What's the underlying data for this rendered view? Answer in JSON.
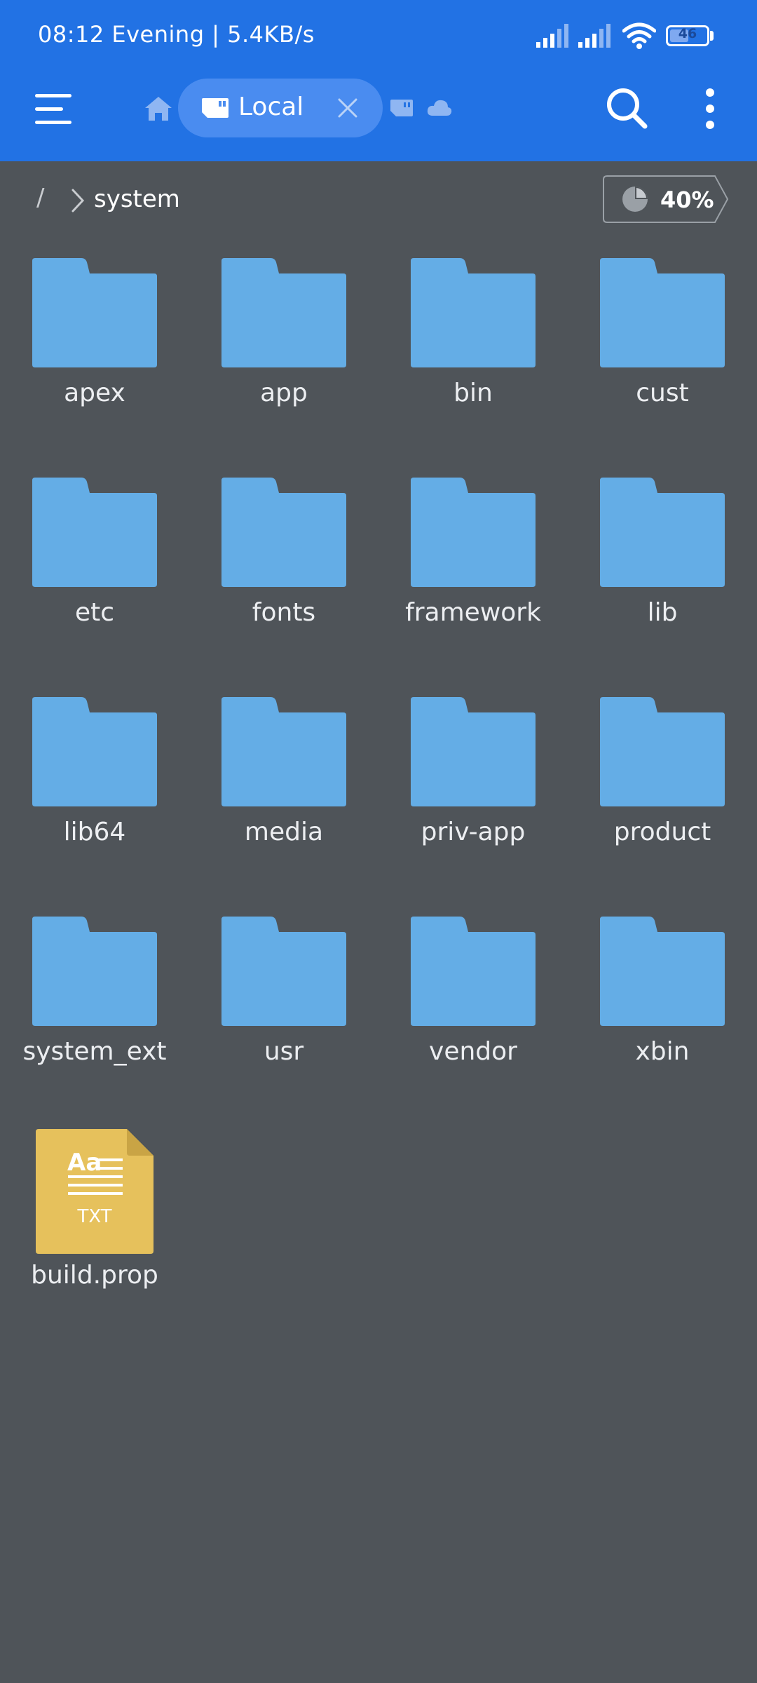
{
  "status_bar": {
    "text": "08:12 Evening | 5.4KB/s",
    "battery_level": "46"
  },
  "toolbar": {
    "tab_label": "Local",
    "colors": {
      "bar": "#2272e4",
      "tab": "#4a8cf0"
    }
  },
  "breadcrumb": {
    "root": "/",
    "current": "system"
  },
  "storage": {
    "percent": "40%"
  },
  "folders": [
    "apex",
    "app",
    "bin",
    "cust",
    "etc",
    "fonts",
    "framework",
    "lib",
    "lib64",
    "media",
    "priv-app",
    "product",
    "system_ext",
    "usr",
    "vendor",
    "xbin"
  ],
  "files": [
    {
      "name": "build.prop",
      "type": "TXT",
      "icon_text": "Aa"
    }
  ],
  "colors": {
    "background": "#4f5459",
    "folder": "#64ade6",
    "txt_file": "#e6c15c"
  }
}
